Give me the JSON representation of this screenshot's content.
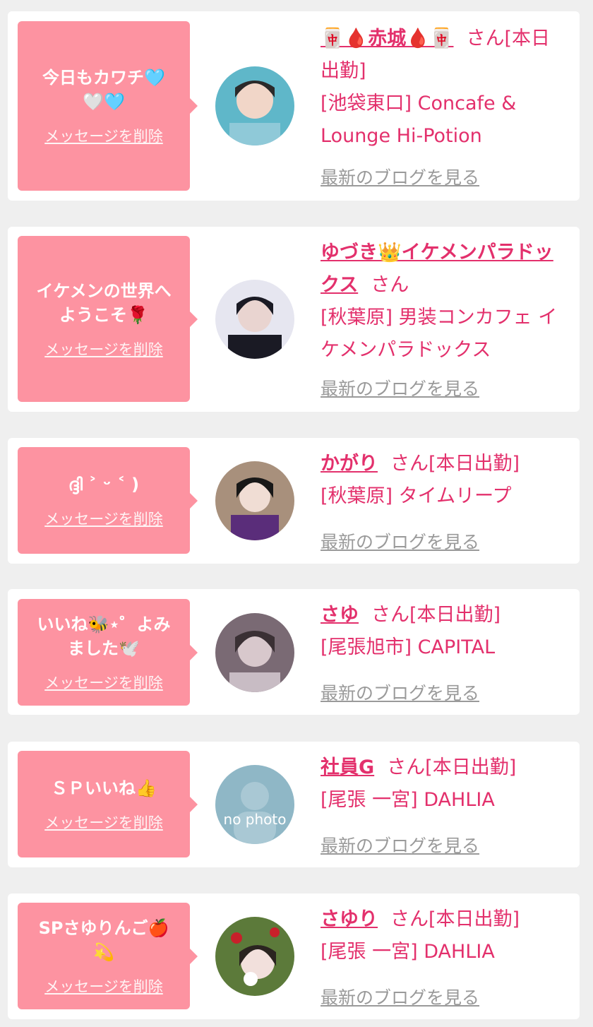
{
  "entries": [
    {
      "message": "今日もカワチ🩵\n🤍🩵",
      "delete_label": "メッセージを削除",
      "name": "🀄🩸赤城🩸🀄",
      "honorific": "さん",
      "status": "[本日出勤]",
      "location": "[池袋東口] Concafe & Lounge Hi-Potion",
      "blog_label": "最新のブログを見る",
      "avatar_colors": [
        "#5fb7c9",
        "#2a2a2a"
      ]
    },
    {
      "message": "イケメンの世界へ\nようこそ🌹",
      "delete_label": "メッセージを削除",
      "name": "ゆづき👑イケメンパラドックス",
      "honorific": "さん",
      "status": "",
      "location": "[秋葉原] 男装コンカフェ イケメンパラドックス",
      "blog_label": "最新のブログを見る",
      "avatar_colors": [
        "#e6e6f0",
        "#1a1a24"
      ]
    },
    {
      "message": "ദ്ദി ˃ ᵕ ˂ )",
      "delete_label": "メッセージを削除",
      "name": "かがり",
      "honorific": "さん",
      "status": "[本日出勤]",
      "location": "[秋葉原] タイムリープ",
      "blog_label": "最新のブログを見る",
      "avatar_colors": [
        "#a8907c",
        "#5a2d7a"
      ]
    },
    {
      "message": "いいね🐝⋆゜よみ\nました🕊️",
      "delete_label": "メッセージを削除",
      "name": "さゆ",
      "honorific": "さん",
      "status": "[本日出勤]",
      "location": "[尾張旭市] CAPITAL",
      "blog_label": "最新のブログを見る",
      "avatar_colors": [
        "#7a6a74",
        "#c8bcc4"
      ]
    },
    {
      "message": "ＳＰいいね👍",
      "delete_label": "メッセージを削除",
      "name": "社員G",
      "honorific": "さん",
      "status": "[本日出勤]",
      "location": "[尾張 一宮] DAHLIA",
      "blog_label": "最新のブログを見る",
      "avatar_colors": [
        "#8fb7c6",
        "#ffffff"
      ],
      "avatar_text": "no photo"
    },
    {
      "message": "SPさゆりんご🍎\n💫",
      "delete_label": "メッセージを削除",
      "name": "さゆり",
      "honorific": "さん",
      "status": "[本日出勤]",
      "location": "[尾張 一宮] DAHLIA",
      "blog_label": "最新のブログを見る",
      "avatar_colors": [
        "#5c7a3a",
        "#2a2420"
      ]
    }
  ]
}
